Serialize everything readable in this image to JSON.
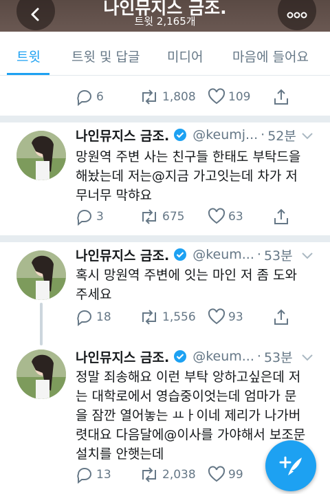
{
  "header": {
    "title": "나인뮤지스 금조.",
    "subtitle": "트윗 2,165개",
    "back_icon": "back-arrow-icon",
    "more_icon": "more-dots-icon"
  },
  "tabs": [
    {
      "label": "트윗",
      "active": true
    },
    {
      "label": "트윗 및 답글",
      "active": false
    },
    {
      "label": "미디어",
      "active": false
    },
    {
      "label": "마음에 들어요",
      "active": false
    }
  ],
  "colors": {
    "accent": "#1da1f2",
    "muted": "#657786",
    "divider": "#e6ecf0"
  },
  "partial_tweet": {
    "replies": "6",
    "retweets": "1,808",
    "likes": "109"
  },
  "tweets": [
    {
      "name": "나인뮤지스 금조.",
      "handle": "@keumj...",
      "time": "52분",
      "text": "망원역 주변 사는 친구들 한태도 부탁드을\n해놨는데 저는@지금 가고잇는데 차가 저\n무너무 막햐요",
      "replies": "3",
      "retweets": "675",
      "likes": "63"
    },
    {
      "name": "나인뮤지스 금조.",
      "handle": "@keum...",
      "time": "53분",
      "text": "혹시 망원역 주변에 잇는 마인 저 좀 도와\n주세요",
      "replies": "18",
      "retweets": "1,556",
      "likes": "93"
    },
    {
      "name": "나인뮤지스 금조.",
      "handle": "@keum...",
      "time": "53분",
      "text": "정말 죄송해요 이런 부탁 앙하고싶은데 저\n는 대학로에서 영습중이엇는데 엄마가 문\n을 잠깐 열어놓는 ㅛㅏ이네 제리가 나가버\n렷대요 다음달에@이사를 가야해서 보조문\n설치를 안햇는데",
      "replies": "13",
      "retweets": "2,038",
      "likes": "99"
    }
  ],
  "fab": {
    "icon": "compose-tweet-icon"
  }
}
